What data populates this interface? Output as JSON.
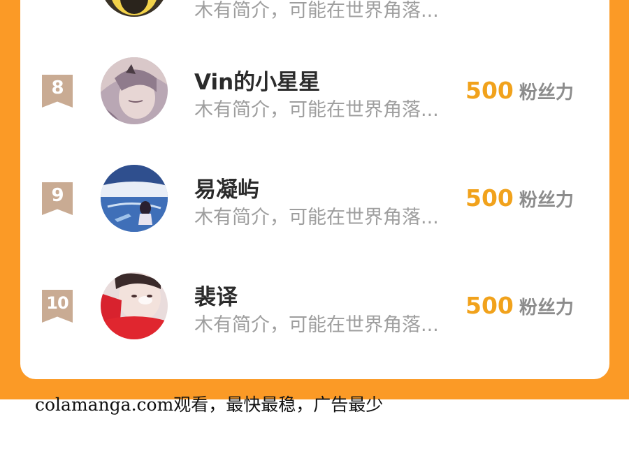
{
  "ranking": {
    "partial_row": {
      "bio": "木有简介，可能在世界角落..."
    },
    "rows": [
      {
        "rank": "8",
        "name": "Vin的小星星",
        "bio": "木有简介，可能在世界角落...",
        "fans_count": "500",
        "fans_label": "粉丝力"
      },
      {
        "rank": "9",
        "name": "易凝屿",
        "bio": "木有简介，可能在世界角落...",
        "fans_count": "500",
        "fans_label": "粉丝力"
      },
      {
        "rank": "10",
        "name": "裴译",
        "bio": "木有简介，可能在世界角落...",
        "fans_count": "500",
        "fans_label": "粉丝力"
      }
    ]
  },
  "footer": {
    "watermark": "colamanga.com观看，最快最稳，广告最少"
  },
  "colors": {
    "page_background": "#fb9a26",
    "card_background": "#ffffff",
    "fans_number": "#f1a21c",
    "rank_flag": "#c9ab93",
    "name_text": "#2b2b2b",
    "bio_text": "#9e9e9e"
  }
}
